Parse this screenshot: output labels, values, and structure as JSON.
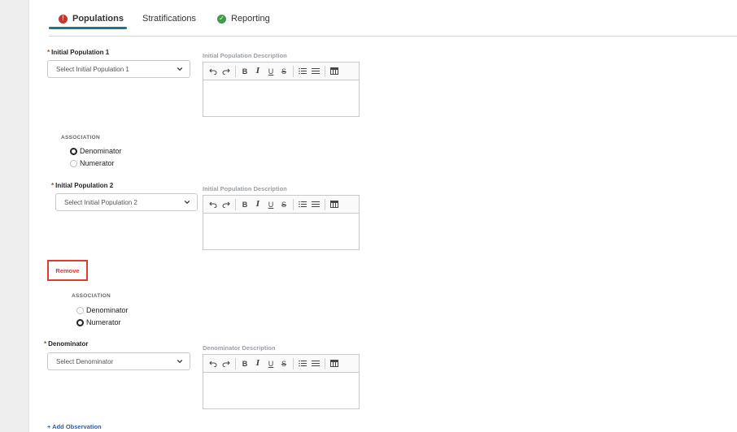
{
  "tabs": [
    {
      "label": "Populations",
      "status_icon": "error-icon",
      "status_color": "#c0392b",
      "active": true
    },
    {
      "label": "Stratifications",
      "active": false
    },
    {
      "label": "Reporting",
      "status_icon": "check-circle-icon",
      "status_color": "#3c9c48",
      "active": false
    }
  ],
  "accent_color": "#127a8a",
  "required_mark": "*",
  "description_editor": {
    "toolbar": [
      "undo-icon",
      "redo-icon",
      "bold",
      "italic",
      "underline",
      "strikethrough",
      "ordered-list-icon",
      "bullet-list-icon",
      "table-icon"
    ],
    "bold_glyph": "B",
    "italic_glyph": "I",
    "underline_glyph": "U",
    "strike_glyph": "S"
  },
  "population1": {
    "label": "Initial Population 1",
    "select_placeholder": "Select Initial Population 1",
    "description_label": "Initial Population Description",
    "association": {
      "title": "ASSOCIATION",
      "options": [
        "Denominator",
        "Numerator"
      ],
      "selected": "Denominator"
    }
  },
  "population2": {
    "label": "Initial Population 2",
    "select_placeholder": "Select Initial Population 2",
    "description_label": "Initial Population Description",
    "remove_label": "Remove",
    "association": {
      "title": "ASSOCIATION",
      "options": [
        "Denominator",
        "Numerator"
      ],
      "selected": "Numerator"
    }
  },
  "denominator": {
    "label": "Denominator",
    "select_placeholder": "Select Denominator",
    "description_label": "Denominator Description"
  },
  "add_observation_label": "+ Add Observation"
}
